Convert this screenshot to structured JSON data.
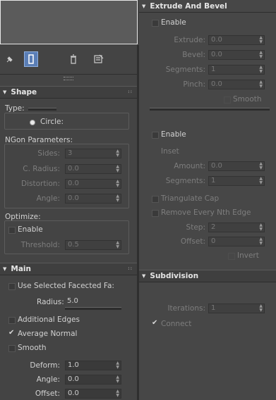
{
  "toolbar": {
    "icons": [
      "pin-icon",
      "show-end-result-icon",
      "remove-modifier-icon",
      "configure-modifier-sets-icon"
    ]
  },
  "shape": {
    "title": "Shape",
    "type_label": "Type:",
    "circle_label": "Circle:",
    "ngon_title": "NGon Parameters:",
    "sides_label": "Sides:",
    "sides_value": "3",
    "cradius_label": "C. Radius:",
    "cradius_value": "0.0",
    "distortion_label": "Distortion:",
    "distortion_value": "0.0",
    "angle_label": "Angle:",
    "angle_value": "0.0",
    "optimize_title": "Optimize:",
    "enable_label": "Enable",
    "threshold_label": "Threshold:",
    "threshold_value": "0.5"
  },
  "main": {
    "title": "Main",
    "use_selected_label": "Use Selected Facected Fa:",
    "radius_label": "Radius:",
    "radius_value": "5.0",
    "additional_edges_label": "Additional Edges",
    "average_normal_label": "Average Normal",
    "smooth_label": "Smooth",
    "deform_label": "Deform:",
    "deform_value": "1.0",
    "angle_label": "Angle:",
    "angle_value": "0.0",
    "offset_label": "Offset:",
    "offset_value": "0.0"
  },
  "extrude": {
    "title": "Extrude And Bevel",
    "enable_label": "Enable",
    "extrude_label": "Extrude:",
    "extrude_value": "0.0",
    "bevel_label": "Bevel:",
    "bevel_value": "0.0",
    "segments_label": "Segments:",
    "segments_value": "1",
    "pinch_label": "Pinch:",
    "pinch_value": "0.0",
    "smooth_label": "Smooth",
    "enable2_label": "Enable",
    "inset_label": "Inset",
    "amount_label": "Amount:",
    "amount_value": "0.0",
    "segments2_label": "Segments:",
    "segments2_value": "1",
    "triangulate_label": "Triangulate Cap",
    "remove_nth_label": "Remove Every Nth Edge",
    "step_label": "Step:",
    "step_value": "2",
    "offset_label": "Offset:",
    "offset_value": "0",
    "invert_label": "Invert"
  },
  "subdivision": {
    "title": "Subdivision",
    "iterations_label": "Iterations:",
    "iterations_value": "1",
    "connect_label": "Connect"
  }
}
